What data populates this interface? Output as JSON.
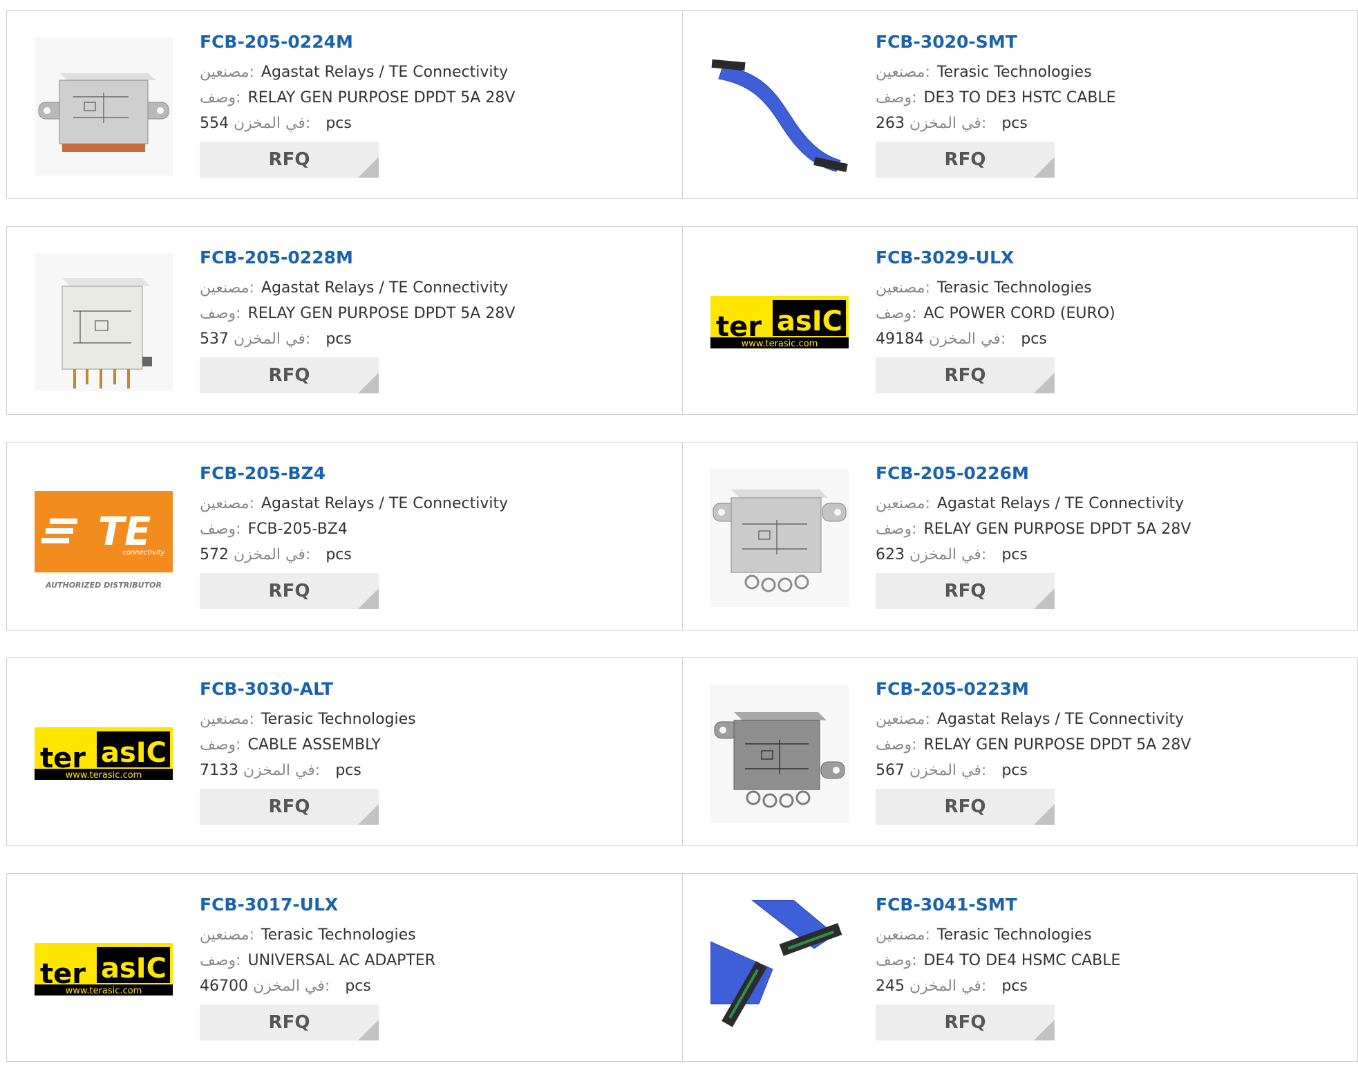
{
  "labels": {
    "manufacturer": "مصنعين:",
    "description": "وصف:",
    "stock": "في المخزن:",
    "unit": "pcs",
    "rfq": "RFQ"
  },
  "rows": [
    [
      {
        "part": "FCB-205-0224M",
        "manufacturer": "Agastat Relays / TE Connectivity",
        "description": "RELAY GEN PURPOSE DPDT 5A 28V",
        "stock": "554",
        "image": "relay-image"
      },
      {
        "part": "FCB-3020-SMT",
        "manufacturer": "Terasic Technologies",
        "description": "DE3 TO DE3 HSTC CABLE",
        "stock": "263",
        "image": "flat-cable-image"
      }
    ],
    [
      {
        "part": "FCB-205-0228M",
        "manufacturer": "Agastat Relays / TE Connectivity",
        "description": "RELAY GEN PURPOSE DPDT 5A 28V",
        "stock": "537",
        "image": "relay-image"
      },
      {
        "part": "FCB-3029-ULX",
        "manufacturer": "Terasic Technologies",
        "description": "AC POWER CORD (EURO)",
        "stock": "49184",
        "image": "terasic-logo"
      }
    ],
    [
      {
        "part": "FCB-205-BZ4",
        "manufacturer": "Agastat Relays / TE Connectivity",
        "description": "FCB-205-BZ4",
        "stock": "572",
        "image": "te-logo"
      },
      {
        "part": "FCB-205-0226M",
        "manufacturer": "Agastat Relays / TE Connectivity",
        "description": "RELAY GEN PURPOSE DPDT 5A 28V",
        "stock": "623",
        "image": "relay-image"
      }
    ],
    [
      {
        "part": "FCB-3030-ALT",
        "manufacturer": "Terasic Technologies",
        "description": "CABLE ASSEMBLY",
        "stock": "7133",
        "image": "terasic-logo"
      },
      {
        "part": "FCB-205-0223M",
        "manufacturer": "Agastat Relays / TE Connectivity",
        "description": "RELAY GEN PURPOSE DPDT 5A 28V",
        "stock": "567",
        "image": "relay-image"
      }
    ],
    [
      {
        "part": "FCB-3017-ULX",
        "manufacturer": "Terasic Technologies",
        "description": "UNIVERSAL AC ADAPTER",
        "stock": "46700",
        "image": "terasic-logo"
      },
      {
        "part": "FCB-3041-SMT",
        "manufacturer": "Terasic Technologies",
        "description": "DE4 TO DE4 HSMC CABLE",
        "stock": "245",
        "image": "connector-cable-image"
      }
    ]
  ],
  "logos": {
    "terasic": {
      "left": "ter",
      "right": "asIC",
      "url": "www.terasic.com"
    },
    "te": {
      "mark": "TE",
      "sub": "connectivity",
      "tagline": "AUTHORIZED DISTRIBUTOR"
    }
  },
  "colors": {
    "part_link": "#1a62ae",
    "border": "#cfcfcf",
    "rfq_bg": "#ededed",
    "te_orange": "#f28c1e",
    "terasic_yellow": "#ffe600"
  }
}
